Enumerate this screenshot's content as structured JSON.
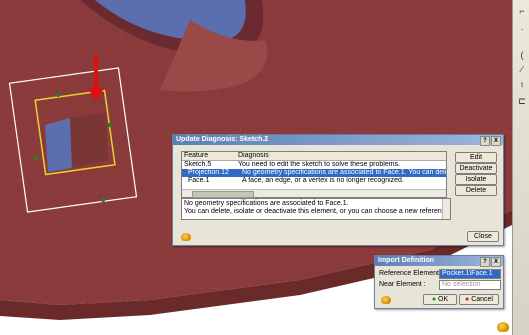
{
  "update_diagnosis": {
    "title": "Update Diagnosis: Sketch.2",
    "columns": [
      "Feature",
      "Diagnosis"
    ],
    "rows": [
      {
        "feature": "Sketch.5",
        "diagnosis": "You need to edit the sketch to solve these problems."
      },
      {
        "feature": "Projection.12",
        "diagnosis": "No geometry specifications are associated to Face.1. You can delete, i..."
      },
      {
        "feature": "Face.1",
        "diagnosis": "A face, an edge, or a vertex is no longer recognized."
      }
    ],
    "message_line1": "No geometry specifications are associated to Face.1.",
    "message_line2": "You can delete, isolate or deactivate this element, or you can choose a new reference elem",
    "buttons": {
      "edit": "Edit",
      "deactivate": "Deactivate",
      "isolate": "Isolate",
      "delete": "Delete",
      "close": "Close"
    },
    "title_buttons": {
      "help": "?",
      "close": "X"
    }
  },
  "import_definition": {
    "title": "Import Definition",
    "reference_label": "Reference Element :",
    "reference_value": "Pocket.1\\Face.1",
    "near_label": "Near Element :",
    "near_placeholder": "No selection",
    "ok_label": "OK",
    "cancel_label": "Cancel",
    "title_buttons": {
      "help": "?",
      "close": "X"
    }
  },
  "toolbar": {
    "icons": [
      "sketch-icon",
      "line-icon",
      "arc-icon",
      "curve-icon",
      "constraint-icon",
      "sheetmetal-icon"
    ]
  },
  "colors": {
    "part": "#8a3a3a",
    "highlight": "#e8d32a",
    "selection": "#316ac5",
    "title": "#5c7fb3",
    "background": "#ffffff"
  }
}
